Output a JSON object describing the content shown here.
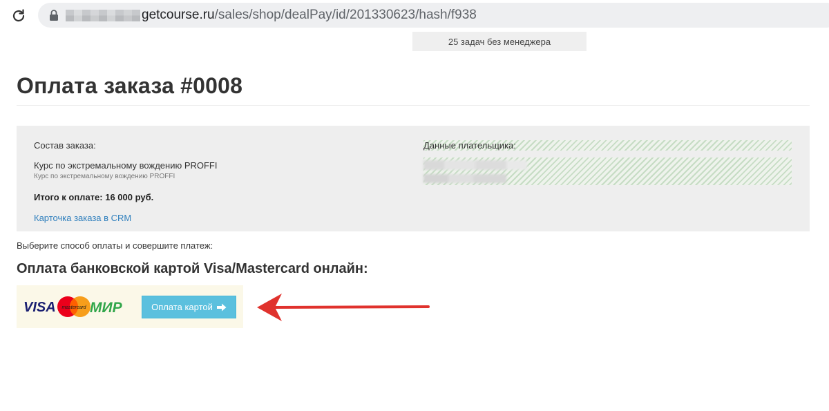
{
  "browser": {
    "url_domain": "getcourse.ru",
    "url_path": "/sales/shop/dealPay/id/201330623/hash/f938",
    "icons": [
      "reload-icon",
      "lock-icon"
    ]
  },
  "top_tab": {
    "label": "25 задач без менеджера"
  },
  "page": {
    "title": "Оплата заказа #0008"
  },
  "order": {
    "composition_label": "Состав заказа:",
    "product_name": "Курс по экстремальному вождению PROFFI",
    "product_sub": "Курс по экстремальному вождению PROFFI",
    "total": "Итого к оплате: 16 000 руб.",
    "crm_link": "Карточка заказа в CRM"
  },
  "payer": {
    "label": "Данные плательщика:"
  },
  "payment": {
    "choose_text": "Выберите способ оплаты и совершите платеж:",
    "method_heading": "Оплата банковской картой Visa/Mastercard онлайн:",
    "logos": {
      "visa": "VISA",
      "mastercard": "mastercard",
      "mir": "МИР"
    },
    "pay_button": "Оплата картой"
  },
  "colors": {
    "panel_bg": "#eeeeee",
    "link": "#2f7fbd",
    "pay_button": "#5bc0de",
    "annotation_arrow": "#e0322d"
  }
}
